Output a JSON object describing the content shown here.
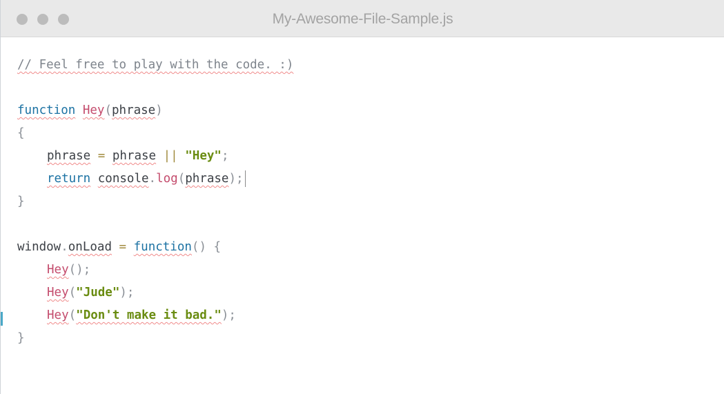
{
  "window": {
    "title": "My-Awesome-File-Sample.js",
    "controls": [
      "close-dot",
      "minimize-dot",
      "zoom-dot"
    ]
  },
  "editor": {
    "comment": "// Feel free to play with the code. :)",
    "kw_function": "function",
    "fn_hey": "Hey",
    "p_open": "(",
    "param": "phrase",
    "p_close": ")",
    "brace_open": "{",
    "brace_close": "}",
    "assign_lhs": "phrase",
    "equals": "=",
    "assign_rhs": "phrase",
    "or_op": "||",
    "str_hey": "\"Hey\"",
    "semi": ";",
    "kw_return": "return",
    "console": "console",
    "dot": ".",
    "log": "log",
    "log_arg": "phrase",
    "call_end": ");",
    "window_obj": "window",
    "onload": "onLoad",
    "fn_parens": "()",
    "brace_space": " {",
    "call_empty": "();",
    "str_jude": "\"Jude\"",
    "str_bad": "\"Don't make it bad.\""
  },
  "colors": {
    "keyword": "#1c72a3",
    "function_name": "#c44c6d",
    "string": "#6a8c11",
    "comment": "#7e848c",
    "titlebar": "#e9e9e9"
  }
}
